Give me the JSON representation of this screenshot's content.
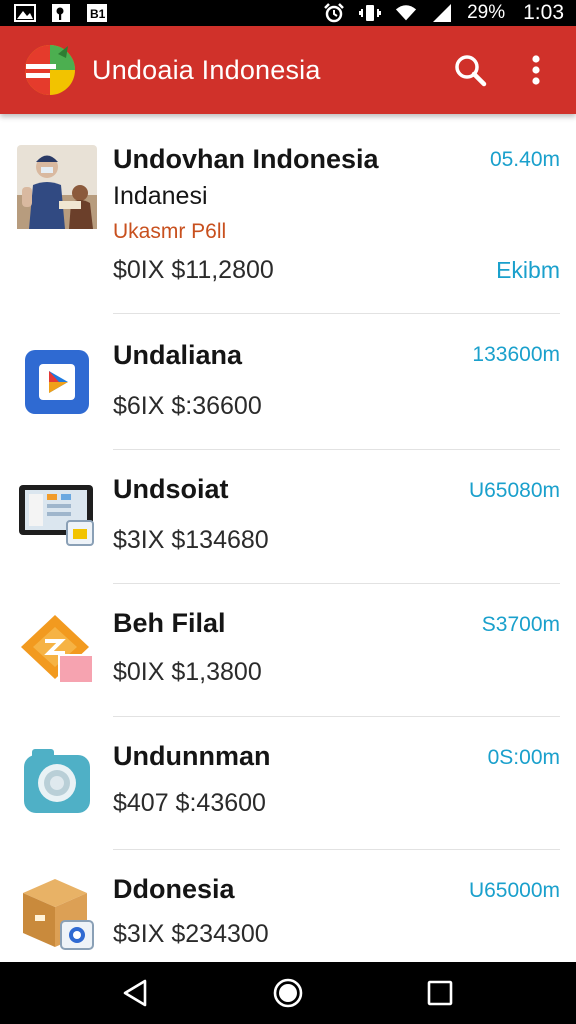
{
  "status_bar": {
    "battery": "29%",
    "time": "1:03",
    "icons": [
      "image-icon",
      "key-icon",
      "notification-icon",
      "alarm-icon",
      "vibrate-icon",
      "wifi-icon",
      "signal-icon"
    ]
  },
  "app_bar": {
    "title": "Undoaia Indonesia",
    "color": "#d0312a",
    "actions": [
      "search-icon",
      "more-vert-icon"
    ]
  },
  "list": {
    "accent_color": "#1aa0cc",
    "items": [
      {
        "title": "Undovhan Indonesia",
        "subtitle": "Indanesi",
        "tag": "Ukasmr P6ll",
        "price": "$0IX $11,2800",
        "size": "05.40m",
        "action": "Ekibm",
        "icon": "photo-people-icon"
      },
      {
        "title": "Undaliana",
        "price": "$6IX $:36600",
        "size": "133600m",
        "icon": "play-store-icon"
      },
      {
        "title": "Undsoiat",
        "price": "$3IX $134680",
        "size": "U65080m",
        "icon": "tablet-app-icon"
      },
      {
        "title": "Beh Filal",
        "price": "$0IX $1,3800",
        "size": "S3700m",
        "icon": "orange-diamond-icon"
      },
      {
        "title": "Undunnman",
        "price": "$407 $:43600",
        "size": "0S:00m",
        "icon": "camera-icon"
      },
      {
        "title": "Ddonesia",
        "price": "$3IX $234300",
        "size": "U65000m",
        "icon": "package-box-icon"
      }
    ]
  },
  "nav_bar": {
    "buttons": [
      "back-icon",
      "home-icon",
      "recents-icon"
    ]
  }
}
